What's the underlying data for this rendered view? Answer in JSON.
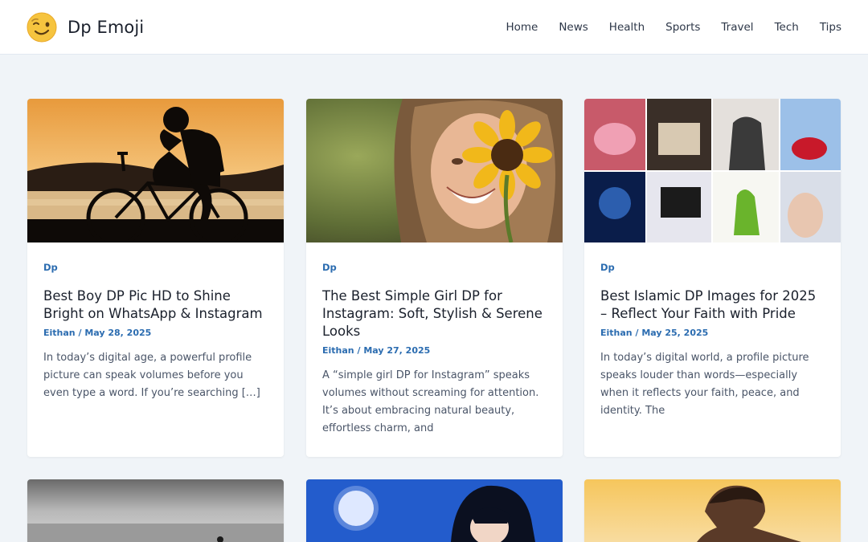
{
  "header": {
    "brand": "Dp Emoji",
    "nav": [
      "Home",
      "News",
      "Health",
      "Sports",
      "Travel",
      "Tech",
      "Tips"
    ]
  },
  "posts": [
    {
      "category": "Dp",
      "title": "Best Boy DP Pic HD to Shine Bright on WhatsApp & Instagram",
      "author": "Eithan",
      "date": "May 28, 2025",
      "excerpt": "In today’s digital age, a powerful profile picture can speak volumes before you even type a word. If you’re searching […]",
      "image": "boy-bicycle-sunset-photo"
    },
    {
      "category": "Dp",
      "title": "The Best Simple Girl DP for Instagram: Soft, Stylish & Serene Looks",
      "author": "Eithan",
      "date": "May 27, 2025",
      "excerpt": "A “simple girl DP for Instagram” speaks volumes without screaming for attention. It’s about embracing natural beauty, effortless charm, and",
      "image": "girl-sunflower-photo"
    },
    {
      "category": "Dp",
      "title": "Best Islamic DP Images for 2025 – Reflect Your Faith with Pride",
      "author": "Eithan",
      "date": "May 25, 2025",
      "excerpt": "In today’s digital world, a profile picture speaks louder than words—especially when it reflects your faith, peace, and identity. The",
      "image": "islamic-collage-photo"
    },
    {
      "image": "beach-grayscale-photo"
    },
    {
      "image": "anime-boy-moon-photo"
    },
    {
      "image": "man-sunset-photo"
    }
  ],
  "colors": {
    "accent": "#2b6cb0",
    "background": "#f0f4f8",
    "card": "#ffffff"
  }
}
